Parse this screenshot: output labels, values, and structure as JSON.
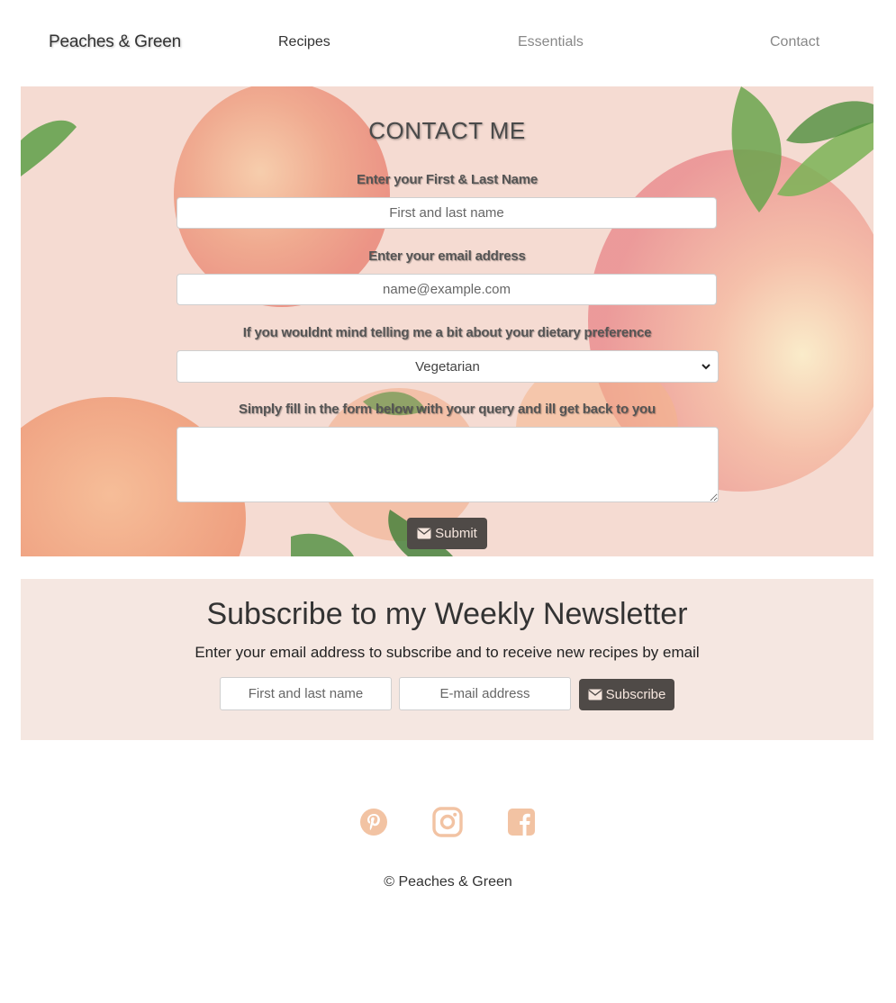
{
  "nav": {
    "brand": "Peaches & Green",
    "links": [
      "Recipes",
      "Essentials",
      "Contact"
    ]
  },
  "contact": {
    "title": "CONTACT ME",
    "name_label": "Enter your First & Last Name",
    "name_placeholder": "First and last name",
    "email_label": "Enter your email address",
    "email_placeholder": "name@example.com",
    "diet_label": "If you wouldnt mind telling me a bit about your dietary preference",
    "diet_selected": "Vegetarian",
    "query_label": "Simply fill in the form below with your query and ill get back to you",
    "submit_label": "Submit"
  },
  "newsletter": {
    "title": "Subscribe to my Weekly Newsletter",
    "subtitle": "Enter your email address to subscribe and to receive new recipes by email",
    "name_placeholder": "First and last name",
    "email_placeholder": "E-mail address",
    "subscribe_label": "Subscribe"
  },
  "footer": {
    "social_icons": [
      "pinterest-icon",
      "instagram-icon",
      "facebook-icon"
    ],
    "copyright": "© Peaches & Green"
  },
  "colors": {
    "hero_bg": "#f5dbd2",
    "newsletter_bg": "#f5e7e1",
    "button_bg": "#4f4a47",
    "social_icon": "#f2c3a3"
  }
}
